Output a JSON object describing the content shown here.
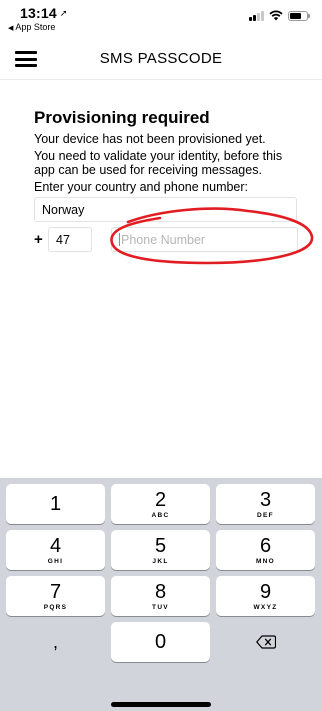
{
  "status_bar": {
    "time": "13:14",
    "location_glyph": "➚",
    "back_app": "App Store",
    "back_glyph": "◀"
  },
  "nav": {
    "title": "SMS PASSCODE",
    "menu_icon": "hamburger-icon"
  },
  "content": {
    "heading": "Provisioning required",
    "line1": "Your device has not been provisioned yet.",
    "line2": "You need to validate your identity, before this app can be used for receiving messages.",
    "line3": "Enter your country and phone number:",
    "country_value": "Norway",
    "plus_sign": "+",
    "country_code": "47",
    "phone_placeholder": "Phone Number"
  },
  "annotation": {
    "color": "#e11d23"
  },
  "keypad": {
    "keys": [
      {
        "num": "1",
        "letters": ""
      },
      {
        "num": "2",
        "letters": "ABC"
      },
      {
        "num": "3",
        "letters": "DEF"
      },
      {
        "num": "4",
        "letters": "GHI"
      },
      {
        "num": "5",
        "letters": "JKL"
      },
      {
        "num": "6",
        "letters": "MNO"
      },
      {
        "num": "7",
        "letters": "PQRS"
      },
      {
        "num": "8",
        "letters": "TUV"
      },
      {
        "num": "9",
        "letters": "WXYZ"
      },
      {
        "num": ",",
        "letters": ""
      },
      {
        "num": "0",
        "letters": ""
      },
      {
        "num": "",
        "letters": ""
      }
    ],
    "delete_icon": "backspace-icon"
  }
}
